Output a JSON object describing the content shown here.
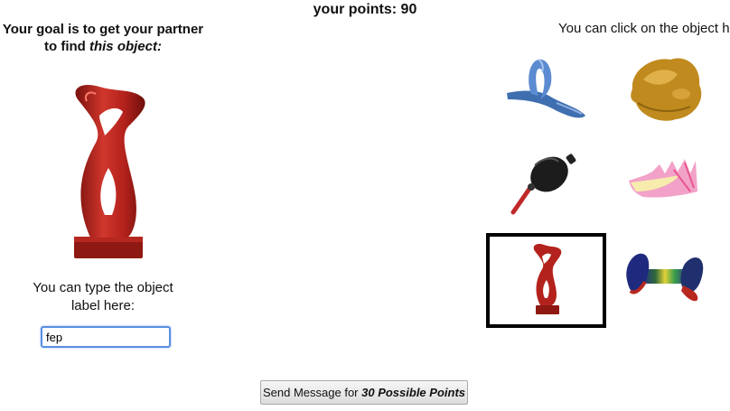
{
  "header": {
    "points_label": "your points: 90"
  },
  "left_panel": {
    "goal_line1": "Your goal is to get your partner",
    "goal_line2_prefix": "to find ",
    "goal_line2_emphasis": "this object:",
    "target_icon": "red-twisted-vase-sculpture",
    "type_prompt_line1": "You can type the object",
    "type_prompt_line2": "label here:",
    "label_input_value": "fep"
  },
  "right_panel": {
    "click_prompt": "You can click on the object here",
    "objects": [
      {
        "icon": "blue-twisted-loop-object",
        "selected": false
      },
      {
        "icon": "amber-blob-object",
        "selected": false
      },
      {
        "icon": "black-bulb-blower-object",
        "selected": false
      },
      {
        "icon": "pink-yellow-crown-object",
        "selected": false
      },
      {
        "icon": "red-twisted-vase-sculpture",
        "selected": true
      },
      {
        "icon": "multicolor-bone-object",
        "selected": false
      }
    ]
  },
  "footer": {
    "send_prefix": "Send Message for ",
    "send_emphasis": "30 Possible Points"
  },
  "colors": {
    "selection_border": "#000000",
    "input_focus": "#5a8fe0",
    "vase_red": "#b3221c"
  }
}
